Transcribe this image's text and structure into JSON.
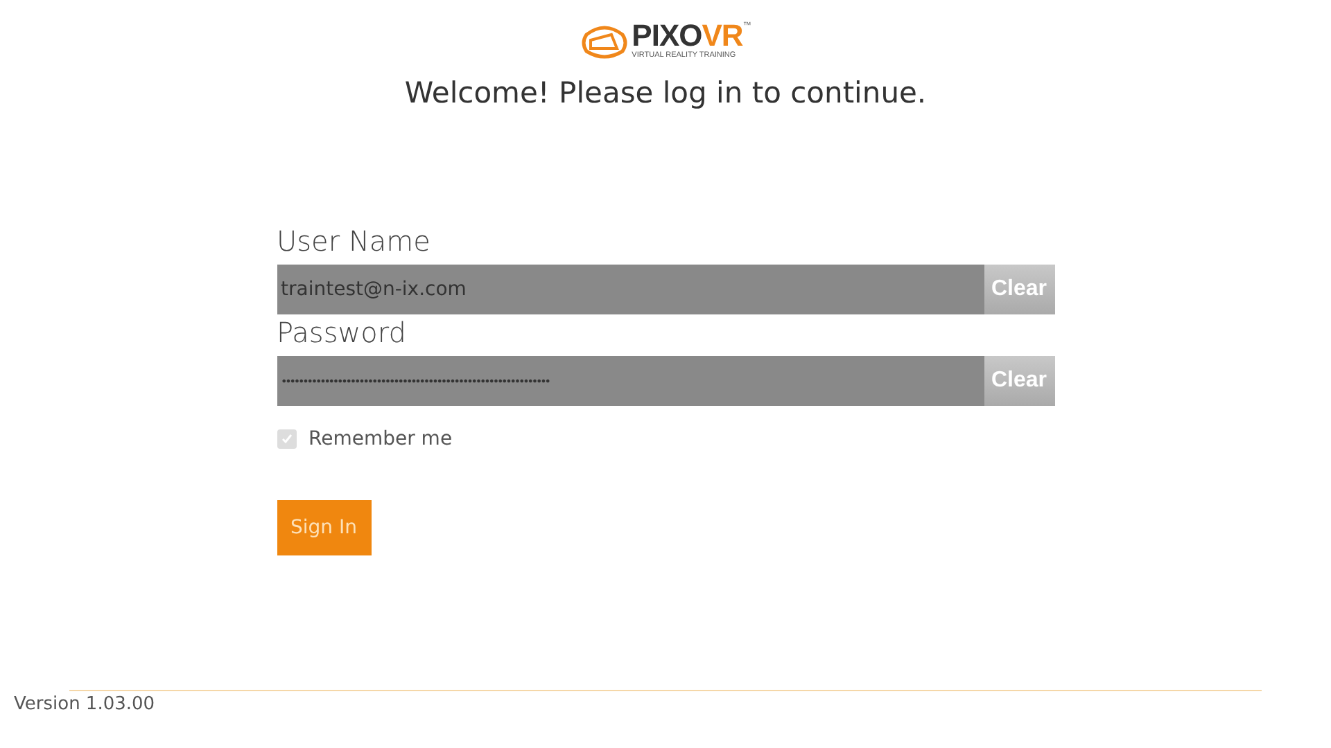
{
  "logo": {
    "brand_dark": "PIXO",
    "brand_accent": "VR",
    "trademark": "™",
    "tagline": "VIRTUAL REALITY TRAINING"
  },
  "heading": "Welcome! Please log in to continue.",
  "fields": [
    {
      "label": "User Name",
      "value": "traintest@n-ix.com",
      "clear": "Clear"
    },
    {
      "label": "Password",
      "value": "••••••••••••••••••••••••••••••••••••••••••••••••••••••••••••••",
      "clear": "Clear"
    }
  ],
  "remember": {
    "label": "Remember me",
    "checked": true
  },
  "sign_in": "Sign In",
  "version": "Version 1.03.00"
}
